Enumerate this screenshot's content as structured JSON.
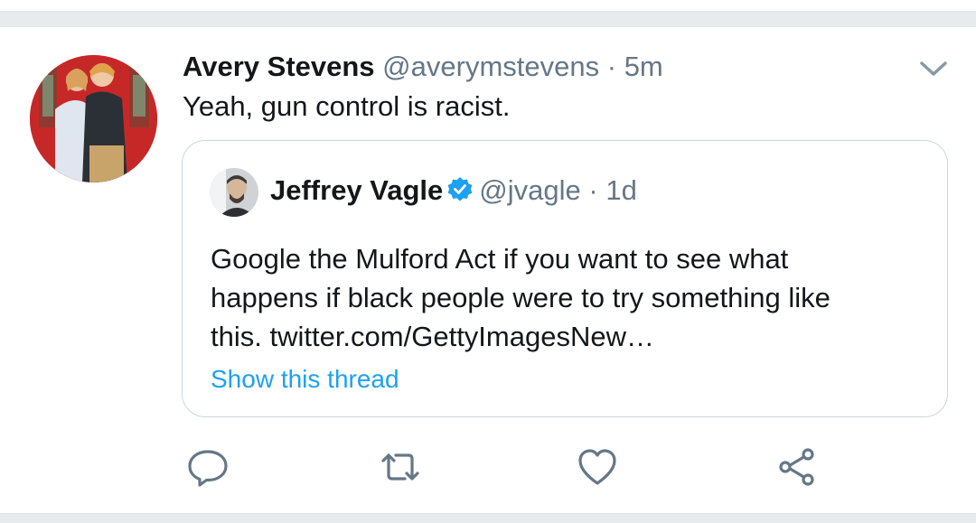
{
  "tweet": {
    "author_name": "Avery Stevens",
    "author_handle": "@averymstevens",
    "separator": "·",
    "time": "5m",
    "text": "Yeah, gun control is racist.",
    "avatar_icon": "profile-photo-avatar",
    "menu_icon": "chevron-down-icon"
  },
  "quoted": {
    "author_name": "Jeffrey Vagle",
    "verified_icon": "verified-badge-icon",
    "author_handle": "@jvagle",
    "separator": "·",
    "time": "1d",
    "text_lines": [
      "Google the Mulford Act if you want to see what",
      "happens if black people were to try something like",
      "this. twitter.com/GettyImagesNew…"
    ],
    "thread_link": "Show this thread"
  },
  "actions": [
    {
      "icon": "reply-icon"
    },
    {
      "icon": "retweet-icon"
    },
    {
      "icon": "like-icon"
    },
    {
      "icon": "share-icon"
    }
  ],
  "colors": {
    "text": "#14171a",
    "muted": "#657786",
    "link": "#1da1f2",
    "verified": "#1da1f2",
    "border": "#ccd6dd",
    "divider": "#e8ebee"
  }
}
